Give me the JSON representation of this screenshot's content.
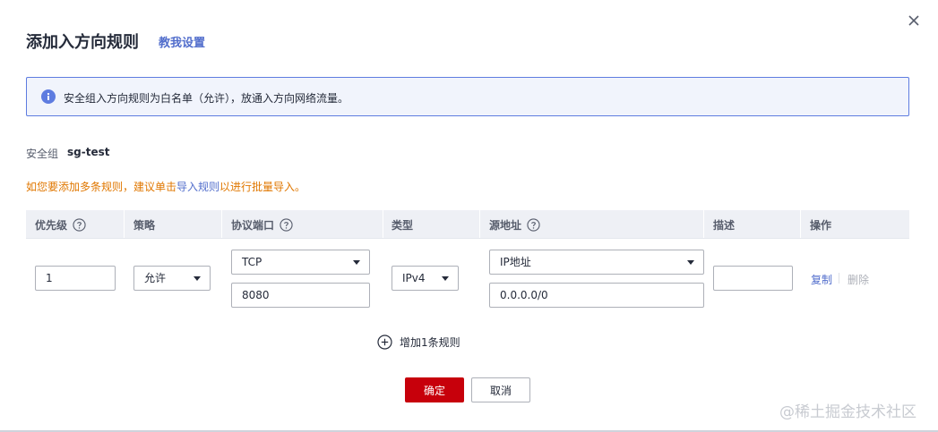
{
  "dialog": {
    "title": "添加入方向规则",
    "help_link": "教我设置"
  },
  "info": {
    "text": "安全组入方向规则为白名单（允许），放通入方向网络流量。"
  },
  "security_group": {
    "label": "安全组",
    "value": "sg-test"
  },
  "tip": {
    "prefix": "如您要添加多条规则，建议单击",
    "link": "导入规则",
    "suffix": "以进行批量导入。"
  },
  "table": {
    "headers": {
      "priority": "优先级",
      "policy": "策略",
      "protocol_port": "协议端口",
      "type": "类型",
      "source": "源地址",
      "description": "描述",
      "actions": "操作"
    },
    "row": {
      "priority": "1",
      "policy": "允许",
      "protocol": "TCP",
      "port": "8080",
      "type": "IPv4",
      "source_type": "IP地址",
      "source_address": "0.0.0.0/0",
      "description": "",
      "copy": "复制",
      "delete": "删除"
    }
  },
  "add_rule": "增加1条规则",
  "buttons": {
    "ok": "确定",
    "cancel": "取消"
  },
  "watermark": "@稀土掘金技术社区",
  "colors": {
    "primary_red": "#c7000b",
    "link_blue": "#526ecc",
    "info_border": "#5e7ce0",
    "tip_orange": "#e07700"
  }
}
